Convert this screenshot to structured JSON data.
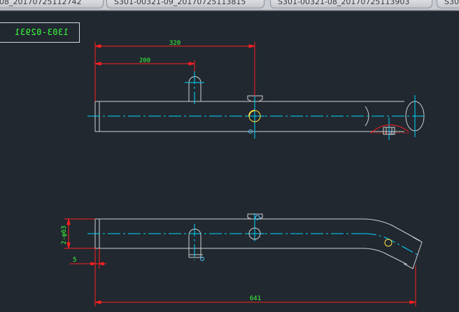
{
  "tabs": [
    {
      "label": "08_20170725112742"
    },
    {
      "label": "S301-00321-09_20170725113815"
    },
    {
      "label": "S301-00321-08_20170725113903"
    },
    {
      "label": "S30"
    }
  ],
  "drawing": {
    "part_number": "1303-02931",
    "dimensions": {
      "top_overall": "320",
      "top_branch": "200",
      "bottom_overall": "641",
      "bottom_diameter": "2-φ63",
      "bottom_offset": "5"
    }
  },
  "colors": {
    "background": "#212830",
    "outline": "#d0d0d0",
    "centerline": "#00d8ff",
    "dimension": "#ff2020",
    "dimension_text": "#3cff3c",
    "marker": "#ffe040"
  }
}
